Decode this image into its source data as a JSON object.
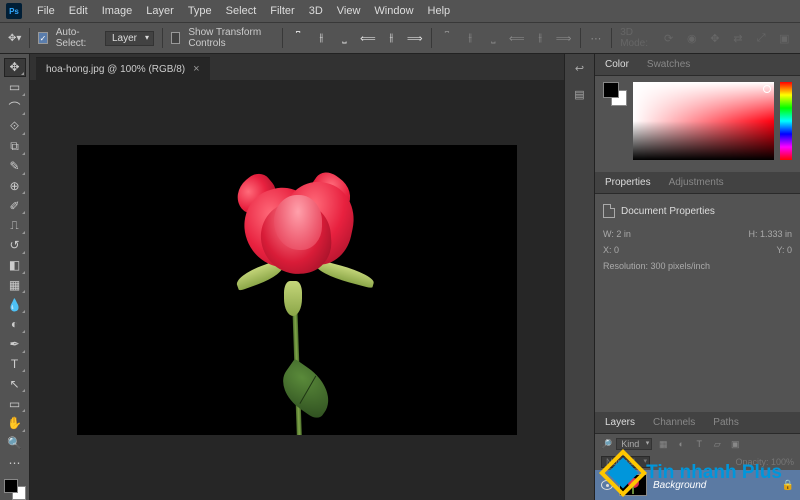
{
  "menu": [
    "File",
    "Edit",
    "Image",
    "Layer",
    "Type",
    "Select",
    "Filter",
    "3D",
    "View",
    "Window",
    "Help"
  ],
  "options": {
    "auto_select_label": "Auto-Select:",
    "auto_select_target": "Layer",
    "show_transform": "Show Transform Controls",
    "mode_3d": "3D Mode:"
  },
  "document": {
    "tab_label": "hoa-hong.jpg @ 100% (RGB/8)"
  },
  "panels": {
    "color_tab": "Color",
    "swatches_tab": "Swatches",
    "properties_tab": "Properties",
    "adjustments_tab": "Adjustments",
    "layers_tab": "Layers",
    "channels_tab": "Channels",
    "paths_tab": "Paths"
  },
  "doc_props": {
    "title": "Document Properties",
    "w_label": "W:",
    "w_value": "2 in",
    "h_label": "H:",
    "h_value": "1.333 in",
    "x_label": "X:",
    "x_value": "0",
    "y_label": "Y:",
    "y_value": "0",
    "res": "Resolution: 300 pixels/inch"
  },
  "layers": {
    "kind": "Kind",
    "mode": "Normal",
    "opacity_label": "Opacity:",
    "opacity_value": "100%",
    "bg_name": "Background"
  },
  "watermark": {
    "text": "Tin nhanh Plus"
  }
}
